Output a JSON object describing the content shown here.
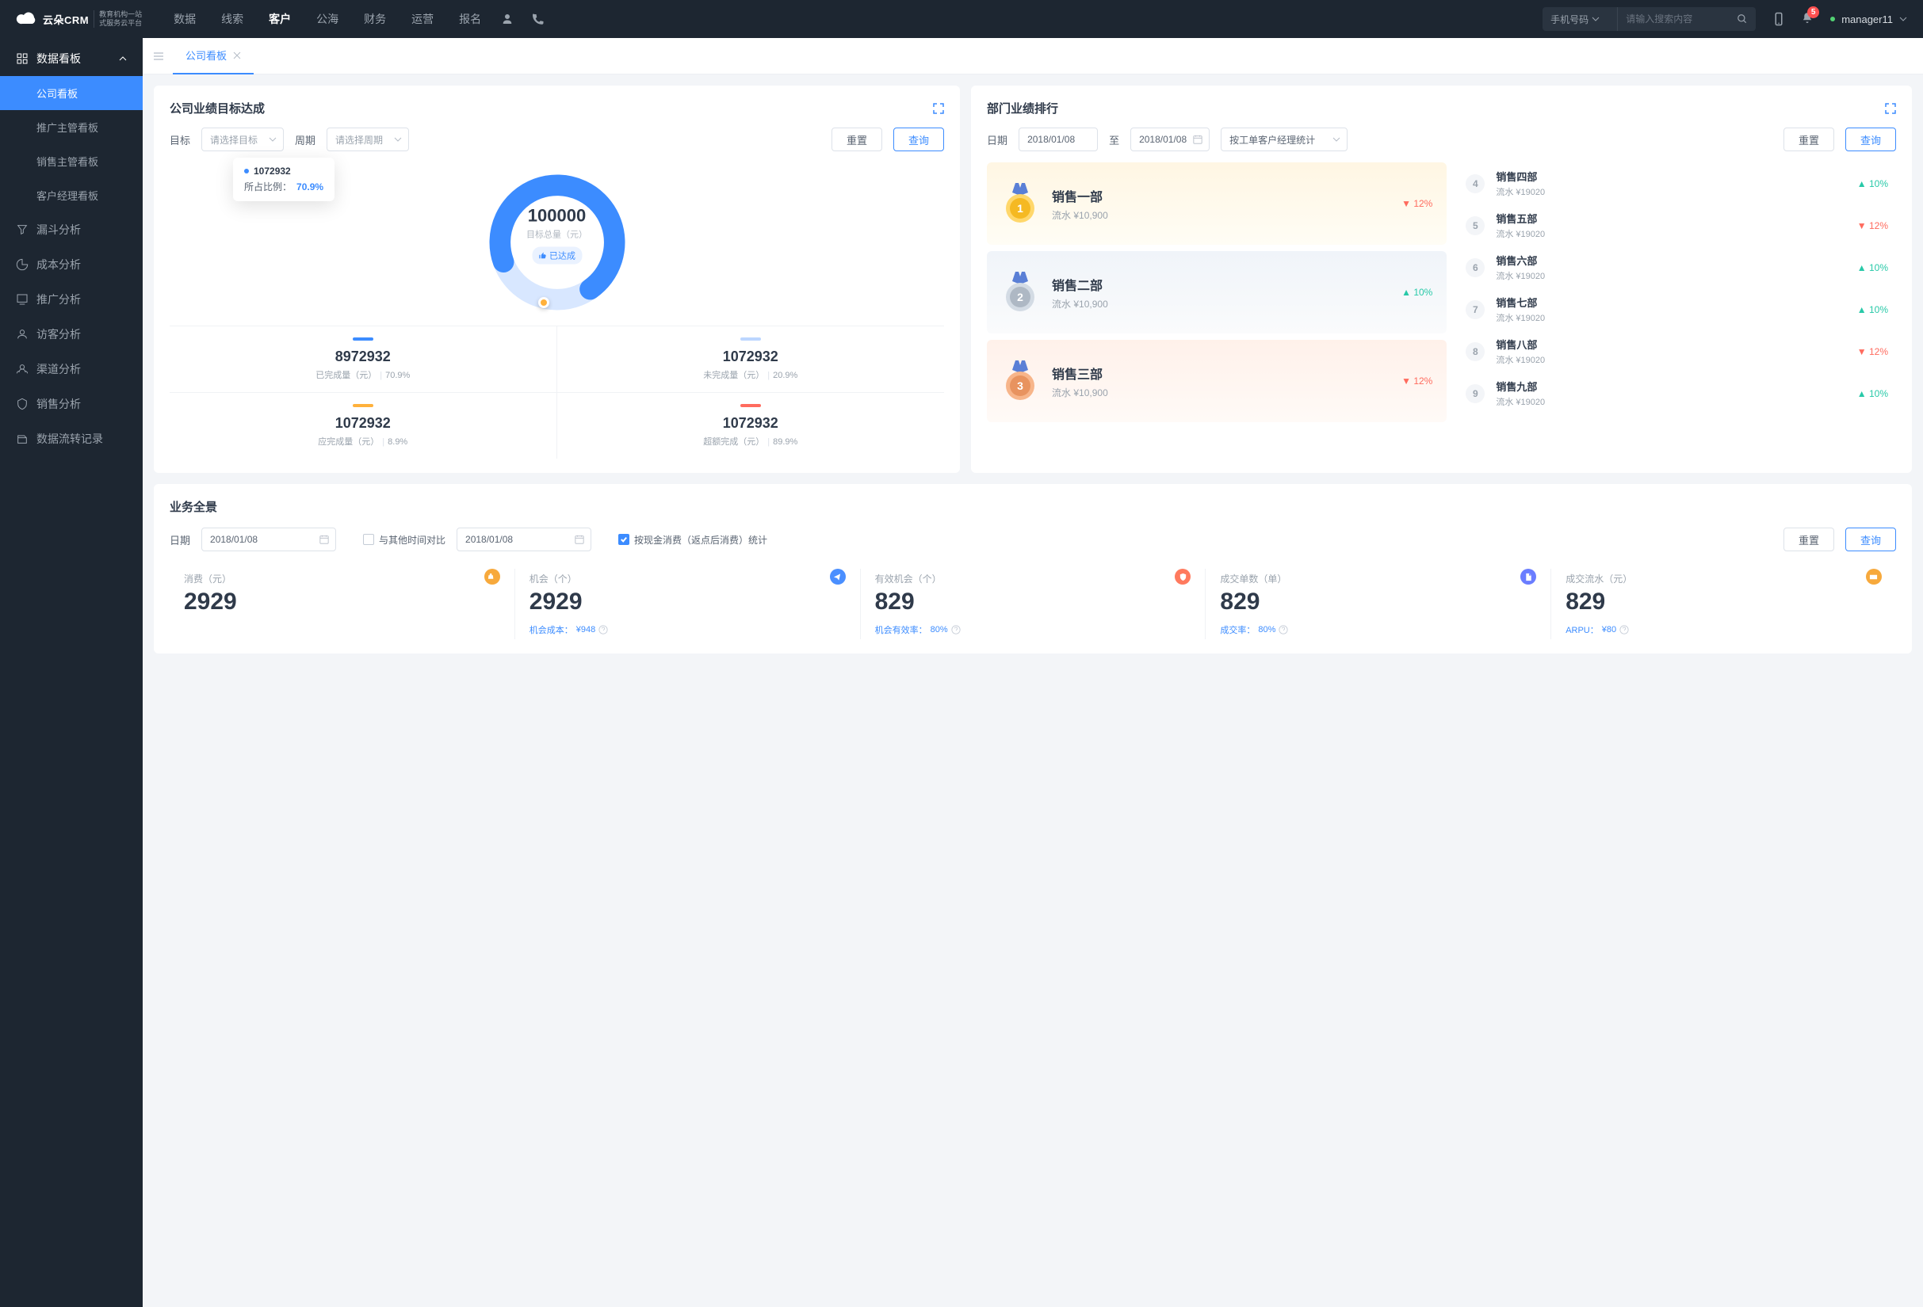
{
  "colors": {
    "primary": "#3c8cff",
    "danger": "#ff6b5e",
    "warn": "#ffb13c",
    "success": "#28c9a8"
  },
  "header": {
    "logo_text": "云朵CRM",
    "logo_sub": "教育机构一站\n式服务云平台",
    "nav": [
      "数据",
      "线索",
      "客户",
      "公海",
      "财务",
      "运营",
      "报名"
    ],
    "active_idx": 2,
    "search_type": "手机号码",
    "search_placeholder": "请输入搜索内容",
    "badge": "5",
    "user": "manager11"
  },
  "sidebar": {
    "head": "数据看板",
    "subs": [
      "公司看板",
      "推广主管看板",
      "销售主管看板",
      "客户经理看板"
    ],
    "active_sub": 0,
    "items": [
      "漏斗分析",
      "成本分析",
      "推广分析",
      "访客分析",
      "渠道分析",
      "销售分析",
      "数据流转记录"
    ]
  },
  "tab": {
    "label": "公司看板"
  },
  "target": {
    "title": "公司业绩目标达成",
    "f_target": "目标",
    "f_target_ph": "请选择目标",
    "f_period": "周期",
    "f_period_ph": "请选择周期",
    "btn_reset": "重置",
    "btn_query": "查询",
    "donut": {
      "total": "100000",
      "total_label": "目标总量（元）",
      "status": "已达成",
      "tooltip_val": "1072932",
      "tooltip_pct_label": "所占比例：",
      "tooltip_pct": "70.9%"
    },
    "stats": [
      {
        "bar": "blue",
        "num": "8972932",
        "label": "已完成量（元）",
        "pct": "70.9%"
      },
      {
        "bar": "lblue",
        "num": "1072932",
        "label": "未完成量（元）",
        "pct": "20.9%"
      },
      {
        "bar": "orange",
        "num": "1072932",
        "label": "应完成量（元）",
        "pct": "8.9%"
      },
      {
        "bar": "red",
        "num": "1072932",
        "label": "超额完成（元）",
        "pct": "89.9%"
      }
    ]
  },
  "rank": {
    "title": "部门业绩排行",
    "f_date": "日期",
    "date_from": "2018/01/08",
    "date_sep": "至",
    "date_to": "2018/01/08",
    "f_group": "按工单客户经理统计",
    "btn_reset": "重置",
    "btn_query": "查询",
    "podium": [
      {
        "name": "销售一部",
        "rev": "流水 ¥10,900",
        "trend": "12%",
        "dir": "dn"
      },
      {
        "name": "销售二部",
        "rev": "流水 ¥10,900",
        "trend": "10%",
        "dir": "up"
      },
      {
        "name": "销售三部",
        "rev": "流水 ¥10,900",
        "trend": "12%",
        "dir": "dn"
      }
    ],
    "list": [
      {
        "n": "4",
        "name": "销售四部",
        "rev": "流水 ¥19020",
        "trend": "10%",
        "dir": "up"
      },
      {
        "n": "5",
        "name": "销售五部",
        "rev": "流水 ¥19020",
        "trend": "12%",
        "dir": "dn"
      },
      {
        "n": "6",
        "name": "销售六部",
        "rev": "流水 ¥19020",
        "trend": "10%",
        "dir": "up"
      },
      {
        "n": "7",
        "name": "销售七部",
        "rev": "流水 ¥19020",
        "trend": "10%",
        "dir": "up"
      },
      {
        "n": "8",
        "name": "销售八部",
        "rev": "流水 ¥19020",
        "trend": "12%",
        "dir": "dn"
      },
      {
        "n": "9",
        "name": "销售九部",
        "rev": "流水 ¥19020",
        "trend": "10%",
        "dir": "up"
      }
    ]
  },
  "overview": {
    "title": "业务全景",
    "f_date": "日期",
    "date1": "2018/01/08",
    "compare_label": "与其他时间对比",
    "date2": "2018/01/08",
    "check_label": "按现金消费（返点后消费）统计",
    "btn_reset": "重置",
    "btn_query": "查询",
    "kpis": [
      {
        "label": "消费（元）",
        "num": "2929",
        "foot_k": "",
        "foot_v": "",
        "ico": "bag",
        "bg": "#ffe9c7"
      },
      {
        "label": "机会（个）",
        "num": "2929",
        "foot_k": "机会成本：",
        "foot_v": "¥948",
        "ico": "send",
        "bg": "#dcebff"
      },
      {
        "label": "有效机会（个）",
        "num": "829",
        "foot_k": "机会有效率：",
        "foot_v": "80%",
        "ico": "shield",
        "bg": "#ffe0d8"
      },
      {
        "label": "成交单数（单）",
        "num": "829",
        "foot_k": "成交率：",
        "foot_v": "80%",
        "ico": "doc",
        "bg": "#e0e7ff"
      },
      {
        "label": "成交流水（元）",
        "num": "829",
        "foot_k": "ARPU：",
        "foot_v": "¥80",
        "ico": "card",
        "bg": "#ffecd0"
      }
    ]
  },
  "chart_data": {
    "type": "pie",
    "title": "公司业绩目标达成",
    "total": 100000,
    "total_label": "目标总量（元）",
    "series": [
      {
        "name": "已完成量",
        "value": 8972932,
        "pct": 70.9,
        "color": "#3c8cff"
      },
      {
        "name": "未完成量",
        "value": 1072932,
        "pct": 20.9,
        "color": "#bcd6ff"
      }
    ],
    "extra": [
      {
        "name": "应完成量",
        "value": 1072932,
        "pct": 8.9
      },
      {
        "name": "超额完成",
        "value": 1072932,
        "pct": 89.9
      }
    ],
    "tooltip": {
      "value": 1072932,
      "pct": 70.9
    },
    "status": "已达成"
  }
}
